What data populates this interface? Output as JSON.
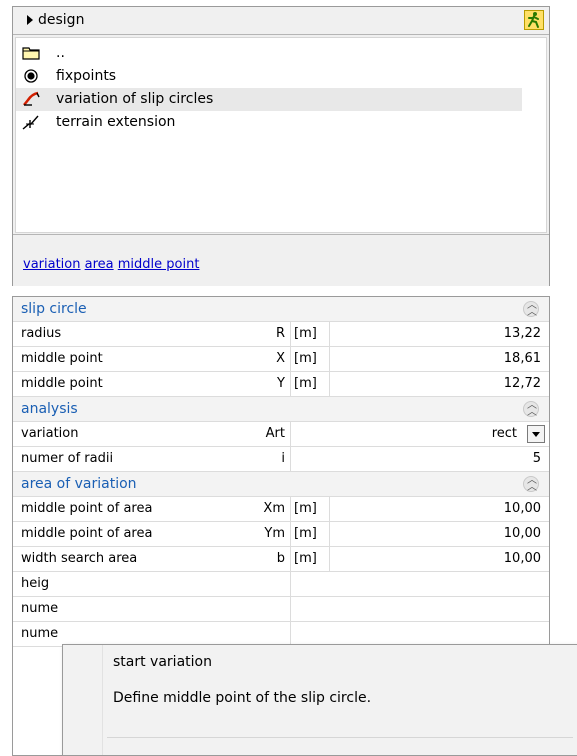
{
  "tree": {
    "breadcrumb": "design",
    "items": [
      {
        "label": "..",
        "icon": "folder-icon"
      },
      {
        "label": "fixpoints",
        "icon": "fixpoint-icon"
      },
      {
        "label": "variation of slip circles",
        "icon": "slip-circle-variation-icon"
      },
      {
        "label": "terrain extension",
        "icon": "terrain-extension-icon"
      }
    ],
    "selected_index": 2,
    "links": [
      "variation",
      "area",
      "middle point"
    ]
  },
  "grid": {
    "sections": [
      {
        "title": "slip circle",
        "rows": [
          {
            "name": "radius",
            "symbol": "R",
            "unit": "[m]",
            "value": "13,22"
          },
          {
            "name": "middle point",
            "symbol": "X",
            "unit": "[m]",
            "value": "18,61"
          },
          {
            "name": "middle point",
            "symbol": "Y",
            "unit": "[m]",
            "value": "12,72"
          }
        ]
      },
      {
        "title": "analysis",
        "rows": [
          {
            "name": "variation",
            "symbol": "Art",
            "unit": "",
            "value": "rect"
          },
          {
            "name": "numer of radii",
            "symbol": "i",
            "unit": "",
            "value": "5"
          }
        ]
      },
      {
        "title": "area of variation",
        "rows": [
          {
            "name": "middle point of area",
            "symbol": "Xm",
            "unit": "[m]",
            "value": "10,00"
          },
          {
            "name": "middle point of area",
            "symbol": "Ym",
            "unit": "[m]",
            "value": "10,00"
          },
          {
            "name": "width search area",
            "symbol": "b",
            "unit": "[m]",
            "value": "10,00"
          },
          {
            "name": "heig",
            "symbol": "",
            "unit": "",
            "value": ""
          },
          {
            "name": "nume",
            "symbol": "",
            "unit": "",
            "value": ""
          },
          {
            "name": "nume",
            "symbol": "",
            "unit": "",
            "value": ""
          }
        ]
      }
    ]
  },
  "context_menu": {
    "items": [
      "start variation",
      "Define middle point of the slip circle."
    ]
  },
  "colors": {
    "section_title": "#1a5fb4",
    "link": "#0000cc",
    "selection": "#e8e8e8"
  }
}
